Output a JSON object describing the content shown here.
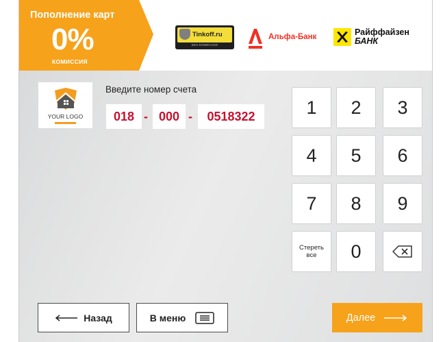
{
  "header": {
    "promo": {
      "title": "Пополнение карт",
      "percent": "0%",
      "subtitle": "КОМИССИЯ"
    },
    "partners": {
      "tinkoff_name": "Tinkoff.ru",
      "tinkoff_sub": "БЕЗ КОМИССИИ",
      "alfa_name": "Альфа-Банк",
      "raif_line1": "Райффайзен",
      "raif_line2": "БАНК"
    }
  },
  "brand": {
    "logo_text": "YOUR LOGO"
  },
  "form": {
    "prompt": "Введите номер счета",
    "account_parts": [
      "018",
      "000",
      "0518322"
    ],
    "separator": "-"
  },
  "keypad": {
    "keys": [
      "1",
      "2",
      "3",
      "4",
      "5",
      "6",
      "7",
      "8",
      "9"
    ],
    "clear_line1": "Стереть",
    "clear_line2": "все",
    "zero": "0"
  },
  "footer": {
    "back_label": "Назад",
    "menu_label": "В меню",
    "next_label": "Далее"
  },
  "colors": {
    "accent": "#f7a21b",
    "account_text": "#c8102e",
    "alfa_red": "#ef3124",
    "raif_yellow": "#fee600"
  }
}
